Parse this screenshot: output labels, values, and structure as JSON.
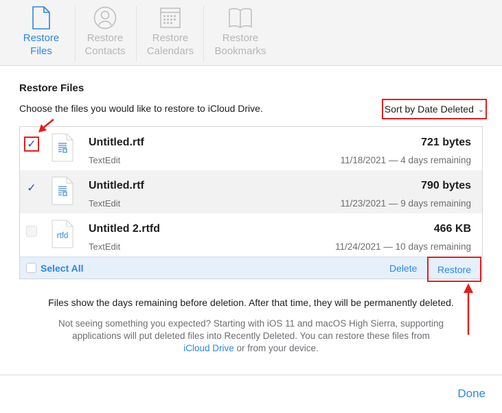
{
  "tabs": [
    {
      "label": "Restore Files",
      "icon": "document-icon",
      "active": true
    },
    {
      "label": "Restore Contacts",
      "icon": "contact-icon",
      "active": false
    },
    {
      "label": "Restore Calendars",
      "icon": "calendar-icon",
      "active": false
    },
    {
      "label": "Restore Bookmarks",
      "icon": "book-icon",
      "active": false
    }
  ],
  "section": {
    "title": "Restore Files",
    "subtitle": "Choose the files you would like to restore to iCloud Drive.",
    "sort_label": "Sort by Date Deleted"
  },
  "files": [
    {
      "name": "Untitled.rtf",
      "app": "TextEdit",
      "size": "721 bytes",
      "date": "11/18/2021 — 4 days remaining",
      "checked": true,
      "icon": "rtf-document-icon"
    },
    {
      "name": "Untitled.rtf",
      "app": "TextEdit",
      "size": "790 bytes",
      "date": "11/23/2021 — 9 days remaining",
      "checked": true,
      "icon": "rtf-document-icon"
    },
    {
      "name": "Untitled 2.rtfd",
      "app": "TextEdit",
      "size": "466 KB",
      "date": "11/24/2021 — 10 days remaining",
      "checked": false,
      "icon": "rtfd-document-icon",
      "icon_text": "rtfd"
    }
  ],
  "footer": {
    "select_all": "Select All",
    "delete": "Delete",
    "restore": "Restore"
  },
  "info": {
    "line1": "Files show the days remaining before deletion. After that time, they will be permanently deleted.",
    "line2": "Not seeing something you expected? Starting with iOS 11 and macOS High Sierra, supporting applications will put deleted files into Recently Deleted. You can restore these files from",
    "link": "iCloud Drive",
    "line2_end": " or from your device."
  },
  "done": "Done",
  "colors": {
    "accent": "#2a87e8",
    "annotation": "#e0201b"
  }
}
